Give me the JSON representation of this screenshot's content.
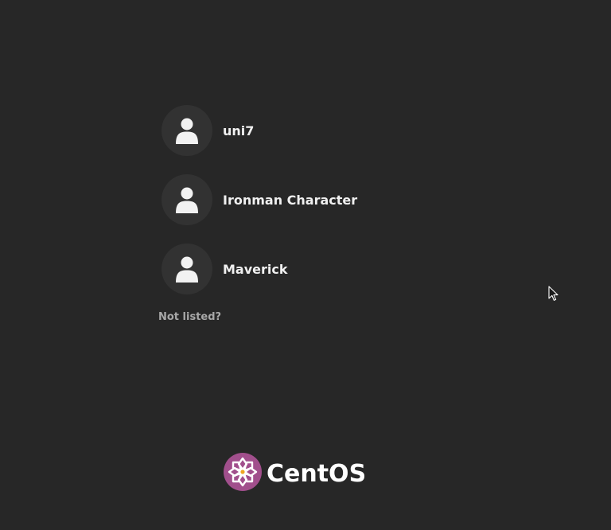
{
  "users": [
    {
      "name": "uni7",
      "icon": "user-avatar-icon"
    },
    {
      "name": "Ironman Character",
      "icon": "user-avatar-icon"
    },
    {
      "name": "Maverick",
      "icon": "user-avatar-icon"
    }
  ],
  "not_listed_label": "Not listed?",
  "logo": {
    "wordmark": "CentOS",
    "icon": "centos-logo-icon",
    "brand_color": "#a14f8c"
  },
  "colors": {
    "background": "#272727",
    "avatar_background": "#323232",
    "text": "#f0f0f0",
    "muted_text": "#a8a8a8"
  }
}
